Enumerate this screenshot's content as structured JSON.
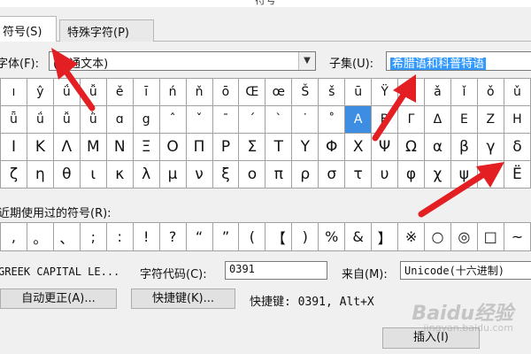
{
  "window": {
    "title": "符号"
  },
  "tabs": [
    {
      "label": "符号(S)",
      "active": true
    },
    {
      "label": "特殊字符(P)",
      "active": false
    }
  ],
  "font": {
    "label": "字体(F):",
    "value": "(普通文本)"
  },
  "subset": {
    "label": "子集(U):",
    "value": "希腊语和科普特语"
  },
  "symbol_grid": {
    "rows": [
      [
        "ı",
        "ŷ",
        "ǘ",
        "ǚ",
        "ě",
        "ī",
        "ń",
        "ň",
        "ō",
        "Œ",
        "œ",
        "Š",
        "š",
        "ū",
        "Ÿ",
        "ƒ",
        "ǎ",
        "ǐ",
        "ǒ",
        "ǔ"
      ],
      [
        "ǖ",
        "ǘ",
        "ǚ",
        "ǜ",
        "ɑ",
        "g",
        "ˆ",
        "ˇ",
        "ˉ",
        "ˊ",
        "ˋ",
        "˙",
        "˚",
        "A",
        "Β",
        "Γ",
        "Δ",
        "Ε",
        "Ζ",
        "Η"
      ],
      [
        "Ι",
        "Κ",
        "Λ",
        "Μ",
        "Ν",
        "Ξ",
        "Ο",
        "Π",
        "Ρ",
        "Σ",
        "Τ",
        "Υ",
        "Φ",
        "Χ",
        "Ψ",
        "Ω",
        "α",
        "β",
        "γ",
        "δ"
      ],
      [
        "ζ",
        "η",
        "θ",
        "ι",
        "κ",
        "λ",
        "μ",
        "ν",
        "ξ",
        "ο",
        "π",
        "ρ",
        "σ",
        "τ",
        "υ",
        "φ",
        "χ",
        "ψ",
        "ω",
        "Ë"
      ]
    ],
    "selected": "A"
  },
  "recent": {
    "label": "近期使用过的符号(R):",
    "symbols": [
      ",",
      "。",
      "、",
      ";",
      ":",
      "!",
      "?",
      "“",
      "”",
      "(",
      "【",
      ")",
      "%",
      "&",
      "】",
      "※",
      "○",
      "◎",
      "□",
      "~"
    ]
  },
  "char_name": "GREEK CAPITAL LE...",
  "char_code": {
    "label": "字符代码(C):",
    "value": "0391"
  },
  "from": {
    "label": "来自(M):",
    "value": "Unicode(十六进制)"
  },
  "buttons": {
    "autocorrect": "自动更正(A)...",
    "shortcut_key": "快捷键(K)...",
    "insert": "插入(I)"
  },
  "shortcut_info": "快捷键: 0391, Alt+X",
  "watermark": {
    "text": "Baidu经验",
    "sub": "jingyan.baidu.com"
  },
  "colors": {
    "selection": "#3d8ee3",
    "arrow": "#e41f23"
  }
}
